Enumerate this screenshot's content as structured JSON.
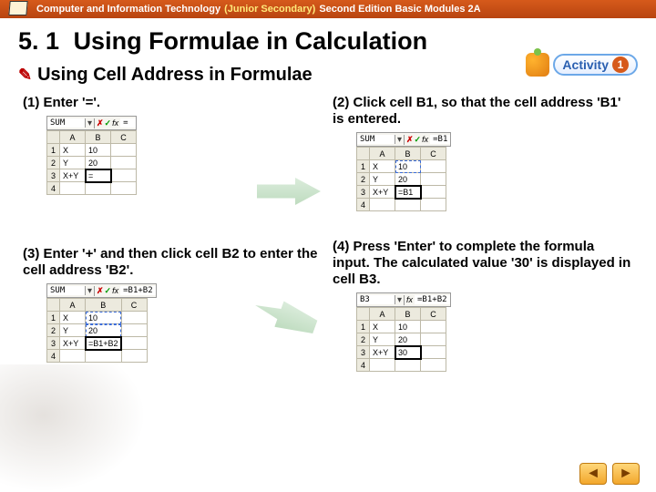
{
  "topbar": {
    "title_main": "Computer and Information Technology",
    "title_level": "(Junior Secondary)",
    "title_tail": "Second Edition Basic Modules 2A"
  },
  "section": {
    "num": "5. 1",
    "title": "Using Formulae in Calculation"
  },
  "subhead": {
    "text": "Using Cell Address in Formulae"
  },
  "activity": {
    "label": "Activity",
    "num": "1"
  },
  "steps": {
    "s1": "(1) Enter '='.",
    "s2": "(2) Click cell B1, so that the cell address 'B1' is entered.",
    "s3": "(3) Enter '+' and then click cell B2 to enter the cell address 'B2'.",
    "s4": "(4) Press 'Enter' to complete the formula input. The calculated value '30' is displayed in cell B3."
  },
  "sheet_common": {
    "cols": [
      "A",
      "B",
      "C"
    ],
    "labels": {
      "x": "X",
      "y": "Y",
      "xy": "X+Y"
    },
    "vals": {
      "b1": "10",
      "b2": "20"
    }
  },
  "sheets": {
    "s1": {
      "name": "SUM",
      "fx": "=",
      "b3": "="
    },
    "s2": {
      "name": "SUM",
      "fx": "=B1",
      "b3": "=B1"
    },
    "s3": {
      "name": "SUM",
      "fx": "=B1+B2",
      "b3": "=B1+B2"
    },
    "s4": {
      "name": "B3",
      "fx": "=B1+B2",
      "b3": "30"
    }
  },
  "icons": {
    "fx_x": "✗",
    "fx_v": "✓",
    "fx_f": "fx"
  },
  "nav": {
    "back": "◄",
    "fwd": "►"
  }
}
